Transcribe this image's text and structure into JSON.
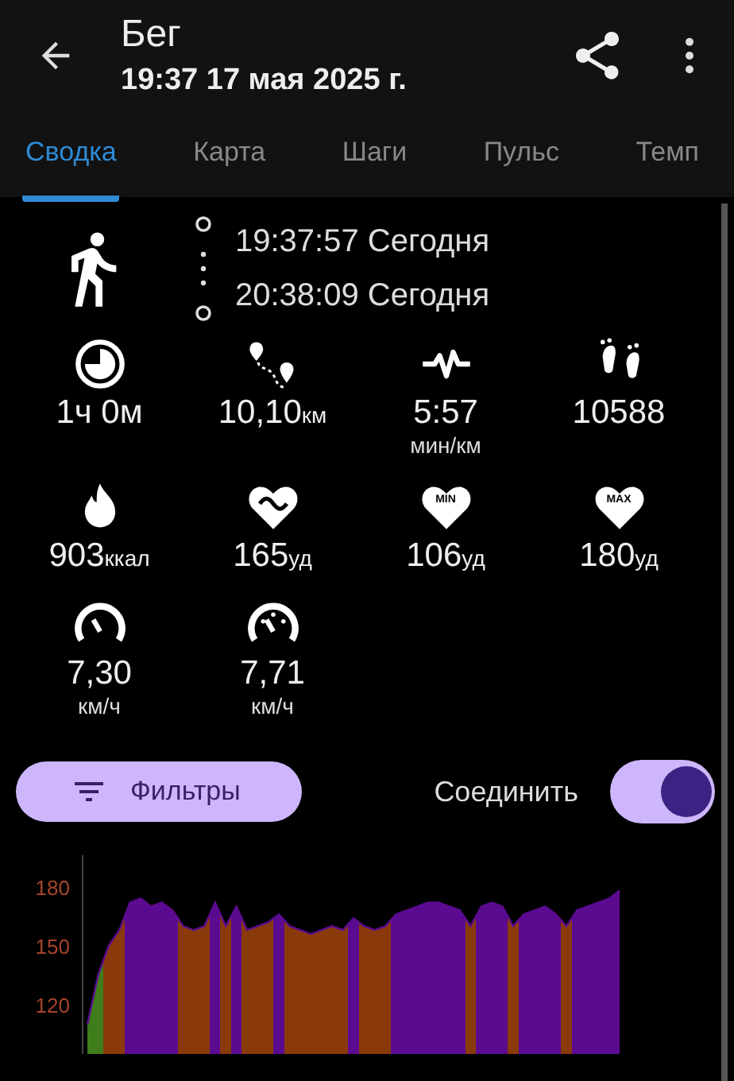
{
  "header": {
    "title": "Бег",
    "subtitle": "19:37 17 мая 2025 г."
  },
  "tabs": [
    {
      "label": "Сводка",
      "selected": true
    },
    {
      "label": "Карта",
      "selected": false
    },
    {
      "label": "Шаги",
      "selected": false
    },
    {
      "label": "Пульс",
      "selected": false
    },
    {
      "label": "Темп",
      "selected": false
    }
  ],
  "session": {
    "start": "19:37:57 Сегодня",
    "end": "20:38:09 Сегодня"
  },
  "metrics": [
    {
      "kind": "duration",
      "value": "1ч 0м"
    },
    {
      "kind": "distance",
      "value": "10,10",
      "unit": "км"
    },
    {
      "kind": "pace",
      "value": "5:57",
      "unit_below": "мин/км"
    },
    {
      "kind": "steps",
      "value": "10588"
    },
    {
      "kind": "calories",
      "value": "903",
      "unit": "ккал"
    },
    {
      "kind": "avg_hr",
      "value": "165",
      "unit": "уд"
    },
    {
      "kind": "min_hr",
      "value": "106",
      "unit": "уд",
      "badge": "MIN"
    },
    {
      "kind": "max_hr",
      "value": "180",
      "unit": "уд",
      "badge": "MAX"
    },
    {
      "kind": "avg_speed",
      "value": "7,30",
      "unit_below": "км/ч"
    },
    {
      "kind": "max_speed",
      "value": "7,71",
      "unit_below": "км/ч"
    }
  ],
  "filters_button": "Фильтры",
  "join": {
    "label": "Соединить",
    "on": true
  },
  "chart_data": {
    "type": "area",
    "ylim": [
      95,
      196
    ],
    "yticks": [
      120,
      150,
      180
    ],
    "categories": [
      null,
      null,
      null,
      null,
      null,
      null,
      null,
      null,
      null,
      null,
      null,
      null,
      null,
      null,
      null,
      null,
      null,
      null,
      null,
      null,
      null,
      null,
      null,
      null,
      null,
      null,
      null,
      null,
      null,
      null,
      null,
      null,
      null,
      null,
      null,
      null,
      null,
      null,
      null,
      null,
      null,
      null,
      null,
      null,
      null,
      null,
      null,
      null,
      null,
      null,
      null
    ],
    "series": [
      {
        "color": "#5b0b8f",
        "values": [
          110,
          135,
          150,
          158,
          172,
          174,
          170,
          172,
          168,
          160,
          158,
          160,
          172,
          160,
          170,
          158,
          160,
          162,
          166,
          160,
          158,
          156,
          158,
          160,
          158,
          164,
          160,
          158,
          160,
          166,
          168,
          170,
          172,
          172,
          170,
          168,
          160,
          170,
          172,
          170,
          160,
          166,
          168,
          170,
          166,
          160,
          168,
          170,
          172,
          174,
          178
        ]
      }
    ]
  }
}
